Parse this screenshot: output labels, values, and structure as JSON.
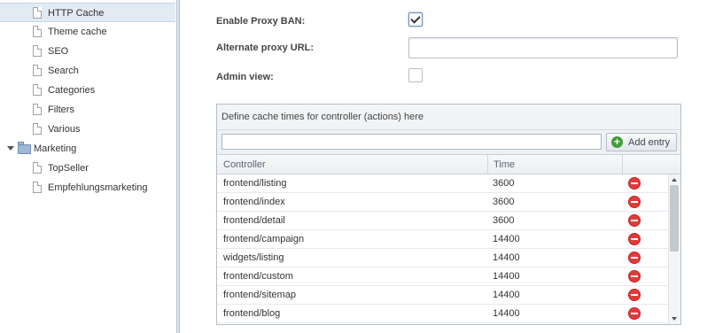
{
  "sidebar": {
    "items": [
      {
        "label": "HTTP Cache",
        "type": "doc",
        "selected": true
      },
      {
        "label": "Theme cache",
        "type": "doc"
      },
      {
        "label": "SEO",
        "type": "doc"
      },
      {
        "label": "Search",
        "type": "doc"
      },
      {
        "label": "Categories",
        "type": "doc"
      },
      {
        "label": "Filters",
        "type": "doc"
      },
      {
        "label": "Various",
        "type": "doc"
      },
      {
        "label": "Marketing",
        "type": "folder",
        "expanded": true
      },
      {
        "label": "TopSeller",
        "type": "doc"
      },
      {
        "label": "Empfehlungsmarketing",
        "type": "doc"
      }
    ]
  },
  "form": {
    "enable_proxy_ban": {
      "label": "Enable Proxy BAN:",
      "checked": true
    },
    "alternate_proxy_url": {
      "label": "Alternate proxy URL:",
      "value": ""
    },
    "admin_view": {
      "label": "Admin view:",
      "checked": false
    }
  },
  "cache_panel": {
    "title": "Define cache times for controller (actions) here",
    "entry_input_value": "",
    "add_button_label": "Add entry",
    "columns": {
      "controller": "Controller",
      "time": "Time"
    },
    "rows": [
      {
        "controller": "frontend/listing",
        "time": "3600"
      },
      {
        "controller": "frontend/index",
        "time": "3600"
      },
      {
        "controller": "frontend/detail",
        "time": "3600"
      },
      {
        "controller": "frontend/campaign",
        "time": "14400"
      },
      {
        "controller": "widgets/listing",
        "time": "14400"
      },
      {
        "controller": "frontend/custom",
        "time": "14400"
      },
      {
        "controller": "frontend/sitemap",
        "time": "14400"
      },
      {
        "controller": "frontend/blog",
        "time": "14400"
      }
    ]
  },
  "icons": {
    "document": "document-icon",
    "folder": "folder-icon",
    "add": "plus-circle-icon",
    "delete": "minus-circle-icon"
  },
  "colors": {
    "selected_row": "#e2eaf3",
    "add_icon": "#3e9d37",
    "delete_icon": "#e23b3b"
  }
}
